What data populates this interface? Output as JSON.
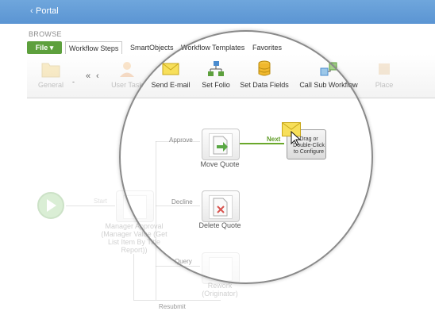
{
  "window": {
    "back_glyph": "‹",
    "title": "Portal"
  },
  "ribbon_tab_row": {
    "section_label": "BROWSE",
    "file_menu": "File ▾",
    "tabs": [
      "Workflow Steps",
      "SmartObjects",
      "Workflow Templates",
      "Favorites"
    ],
    "active_tab": "Workflow Steps"
  },
  "ribbon": {
    "general": "General",
    "nav_dash": "-",
    "nav_prev": "‹",
    "items": [
      {
        "label": "User Task",
        "icon": "user-icon"
      },
      {
        "label": "Send E-mail",
        "icon": "envelope-icon"
      },
      {
        "label": "Set Folio",
        "icon": "hierarchy-icon"
      },
      {
        "label": "Set Data Fields",
        "icon": "database-icon"
      },
      {
        "label": "Call Sub Workflow",
        "icon": "subworkflow-icon"
      },
      {
        "label": "Place",
        "icon": "place-icon"
      }
    ]
  },
  "workflow": {
    "start_label": "Start",
    "steps": {
      "manager_approval": "Manager Approval (Manager Value (Get List Item By Title Report))",
      "move_quote": "Move Quote",
      "delete_quote": "Delete Quote",
      "rework": "Rework (Originator)"
    },
    "lines": {
      "approve": "Approve",
      "decline": "Decline",
      "query": "Query",
      "resubmit": "Resubmit",
      "next": "Next"
    },
    "drop_target_text": "Drag or Double-Click to Configure"
  },
  "colors": {
    "titlebar": "#5b95d3",
    "file_tab": "#5da03d",
    "next_line": "#6aa82b"
  }
}
